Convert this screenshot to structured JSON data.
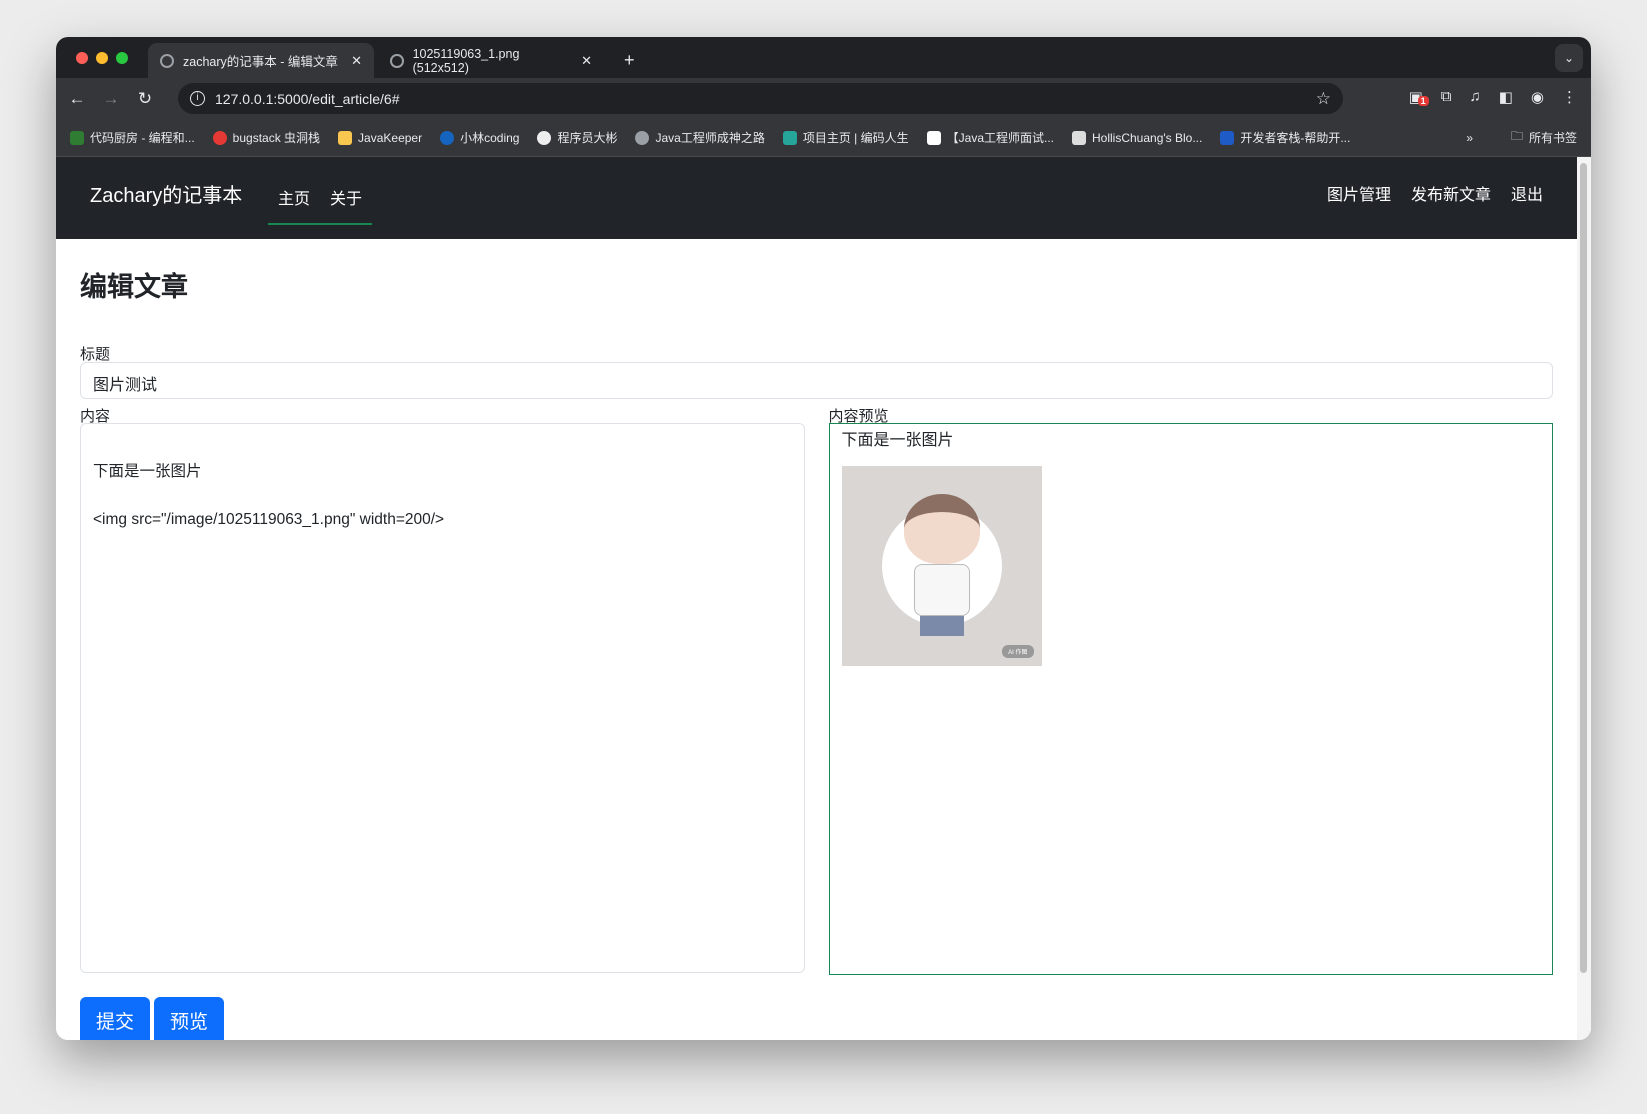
{
  "browser": {
    "tabs": [
      {
        "title": "zachary的记事本 - 编辑文章",
        "active": true
      },
      {
        "title": "1025119063_1.png (512x512)",
        "active": false
      }
    ],
    "url": "127.0.0.1:5000/edit_article/6#",
    "extension_badge": "1",
    "bookmarks": [
      "代码厨房 - 编程和...",
      "bugstack 虫洞栈",
      "JavaKeeper",
      "小林coding",
      "程序员大彬",
      "Java工程师成神之路",
      "项目主页 | 编码人生",
      "【Java工程师面试...",
      "HollisChuang's Blo...",
      "开发者客栈-帮助开..."
    ],
    "all_bookmarks": "所有书签"
  },
  "navbar": {
    "brand": "Zachary的记事本",
    "links": [
      "主页",
      "关于"
    ],
    "right": [
      "图片管理",
      "发布新文章",
      "退出"
    ],
    "accent": "#198754"
  },
  "page": {
    "heading": "编辑文章",
    "title_label": "标题",
    "title_value": "图片测试",
    "content_label": "内容",
    "content_value": "\n下面是一张图片\n\n<img src=\"/image/1025119063_1.png\" width=200/>",
    "preview_label": "内容预览",
    "preview_text": "下面是一张图片",
    "preview_image_badge": "AI 作图",
    "submit": "提交",
    "preview": "预览",
    "button_color": "#0d6efd"
  }
}
